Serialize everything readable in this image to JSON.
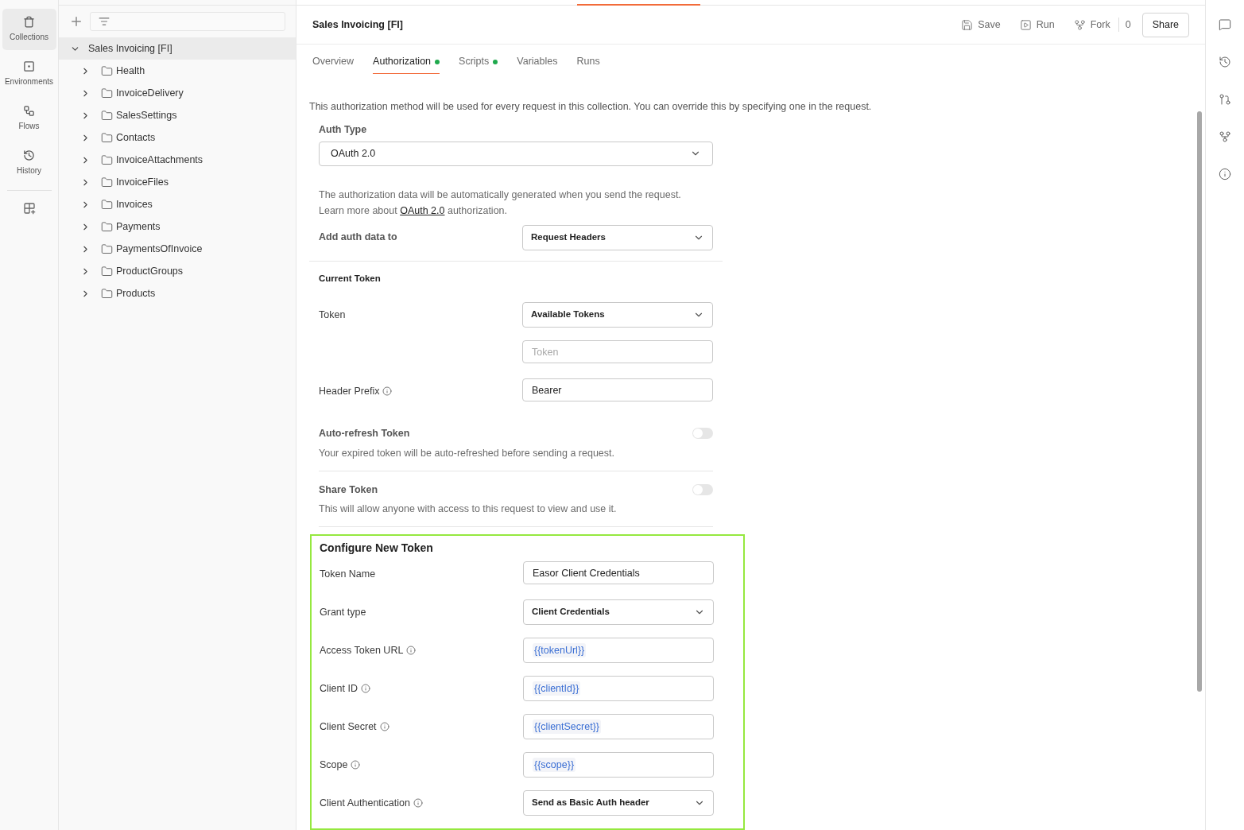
{
  "nav": [
    {
      "kind": "collections",
      "label": "Collections",
      "selected": true
    },
    {
      "kind": "environments",
      "label": "Environments",
      "selected": false
    },
    {
      "kind": "flows",
      "label": "Flows",
      "selected": false
    },
    {
      "kind": "history",
      "label": "History",
      "selected": false
    }
  ],
  "tree": {
    "label": "Sales Invoicing [FI]",
    "expanded": true,
    "selected": true,
    "children": [
      {
        "label": "Health",
        "expanded": false
      },
      {
        "label": "InvoiceDelivery",
        "expanded": false
      },
      {
        "label": "SalesSettings",
        "expanded": false
      },
      {
        "label": "Contacts",
        "expanded": false
      },
      {
        "label": "InvoiceAttachments",
        "expanded": false
      },
      {
        "label": "InvoiceFiles",
        "expanded": false
      },
      {
        "label": "Invoices",
        "expanded": false
      },
      {
        "label": "Payments",
        "expanded": false
      },
      {
        "label": "PaymentsOfInvoice",
        "expanded": false
      },
      {
        "label": "ProductGroups",
        "expanded": false
      },
      {
        "label": "Products",
        "expanded": false
      }
    ]
  },
  "header": {
    "title": "Sales Invoicing [FI]",
    "actions": [
      {
        "kind": "save",
        "label": "Save"
      },
      {
        "kind": "run",
        "label": "Run"
      },
      {
        "kind": "fork",
        "label": "Fork"
      }
    ],
    "fork_count": "0",
    "share": "Share"
  },
  "tabs": [
    {
      "label": "Overview",
      "selected": false,
      "modified": false
    },
    {
      "label": "Authorization",
      "selected": true,
      "modified": true
    },
    {
      "label": "Scripts",
      "selected": false,
      "modified": true
    },
    {
      "label": "Variables",
      "selected": false,
      "modified": false
    },
    {
      "label": "Runs",
      "selected": false,
      "modified": false
    }
  ],
  "description": "This authorization method will be used for every request in this collection. You can override this by specifying one in the request.",
  "auth_type": {
    "label": "Auth Type",
    "value": "OAuth 2.0"
  },
  "info": {
    "line": "The authorization data will be automatically generated when you send the request.",
    "learn_prefix": "Learn more about",
    "link": "OAuth 2.0",
    "learn_suffix": "authorization."
  },
  "add_auth": {
    "label": "Add auth data to",
    "value": "Request Headers"
  },
  "current_token": {
    "heading": "Current Token",
    "rows": [
      {
        "kind": "select",
        "label": "Token",
        "info": false,
        "value": "Available Tokens"
      },
      {
        "kind": "input",
        "info": false,
        "placeholder": "Token"
      },
      {
        "kind": "input",
        "label": "Header Prefix",
        "info": true,
        "value": "Bearer"
      }
    ]
  },
  "toggles": [
    {
      "title": "Auto-refresh Token",
      "description": "Your expired token will be auto-refreshed before sending a request.",
      "on": false
    },
    {
      "title": "Share Token",
      "description": "This will allow anyone with access to this request to view and use it.",
      "on": false
    }
  ],
  "configure": {
    "heading": "Configure New Token",
    "highlighted": true,
    "rows": [
      {
        "kind": "input",
        "label": "Token Name",
        "info": false,
        "value": "Easor Client Credentials"
      },
      {
        "kind": "select",
        "label": "Grant type",
        "info": false,
        "value": "Client Credentials"
      },
      {
        "kind": "variable",
        "label": "Access Token URL",
        "info": true,
        "value": "{{tokenUrl}}"
      },
      {
        "kind": "variable",
        "label": "Client ID",
        "info": true,
        "value": "{{clientId}}"
      },
      {
        "kind": "variable",
        "label": "Client Secret",
        "info": true,
        "value": "{{clientSecret}}"
      },
      {
        "kind": "variable",
        "label": "Scope",
        "info": true,
        "value": "{{scope}}"
      },
      {
        "kind": "select",
        "label": "Client Authentication",
        "info": true,
        "value": "Send as Basic Auth header"
      }
    ]
  }
}
